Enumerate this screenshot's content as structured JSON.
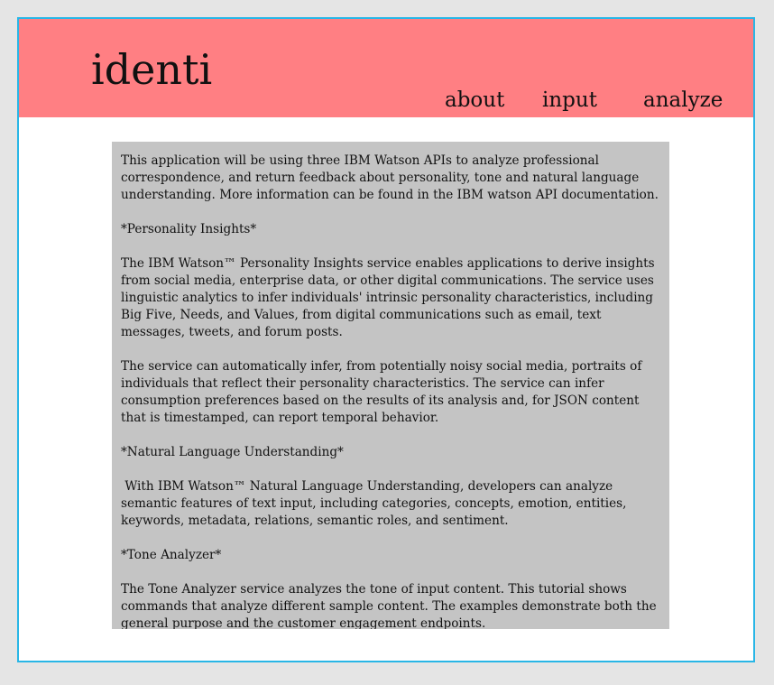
{
  "header": {
    "logo": "identi",
    "nav": {
      "about": "about",
      "input": "input",
      "analyze": "analyze"
    }
  },
  "colors": {
    "page_background": "#e5e5e5",
    "frame_border": "#29b6e6",
    "header_background": "#ff7f83",
    "content_background": "#c4c4c4"
  },
  "content": {
    "paragraphs": [
      "This application will be using three IBM Watson APIs to analyze professional correspondence, and return feedback about personality, tone and natural language understanding. More information can be found in the IBM watson API documentation.",
      "*Personality Insights*",
      "The IBM Watson™ Personality Insights service enables applications to derive insights from social media, enterprise data, or other digital communications. The service uses linguistic analytics to infer individuals' intrinsic personality characteristics, including Big Five, Needs, and Values, from digital communications such as email, text messages, tweets, and forum posts.",
      "The service can automatically infer, from potentially noisy social media, portraits of individuals that reflect their personality characteristics. The service can infer consumption preferences based on the results of its analysis and, for JSON content that is timestamped, can report temporal behavior.",
      "*Natural Language Understanding*",
      " With IBM Watson™ Natural Language Understanding, developers can analyze semantic features of text input, including categories, concepts, emotion, entities, keywords, metadata, relations, semantic roles, and sentiment.",
      "*Tone Analyzer*",
      "The Tone Analyzer service analyzes the tone of input content. This tutorial shows commands that analyze different sample content. The examples demonstrate both the general purpose and the customer engagement endpoints."
    ]
  }
}
